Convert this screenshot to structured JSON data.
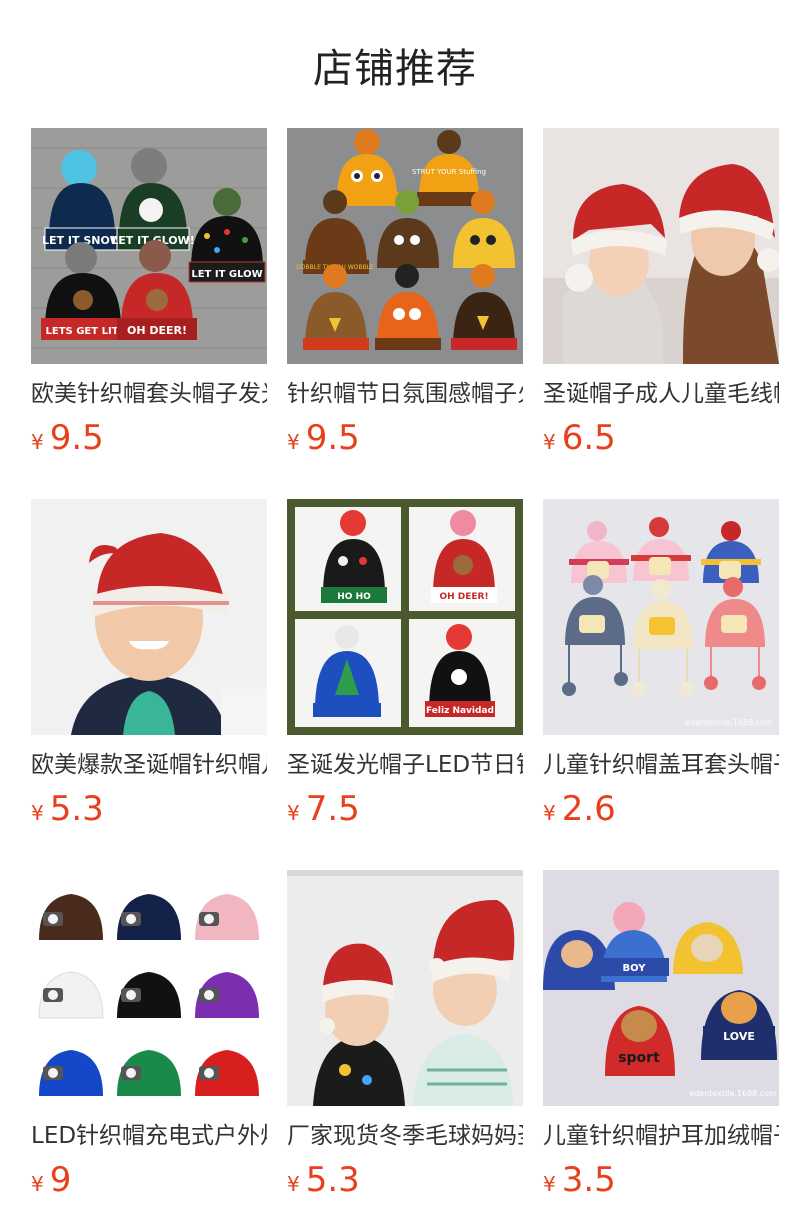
{
  "section": {
    "title": "店铺推荐"
  },
  "products": [
    {
      "name": "欧美针织帽套头帽子发光帽",
      "currency": "¥",
      "price": "9.5",
      "image": "led-christmas-beanies",
      "image_text": [
        "LET IT SNOW",
        "LET IT GLOW!",
        "LET IT GLOW",
        "LETS GET LIT",
        "OH DEER!"
      ]
    },
    {
      "name": "针织帽节日氛围感帽子火鸡帽",
      "currency": "¥",
      "price": "9.5",
      "image": "turkey-beanies",
      "image_text": [
        "STRUT YOUR Stuffing",
        "GOBBLE TIL YOU WOBBLE"
      ]
    },
    {
      "name": "圣诞帽子成人儿童毛线帽",
      "currency": "¥",
      "price": "6.5",
      "image": "santa-hats-mother-child",
      "image_text": []
    },
    {
      "name": "欧美爆款圣诞帽针织帽儿童",
      "currency": "¥",
      "price": "5.3",
      "image": "child-red-knit-hat",
      "image_text": []
    },
    {
      "name": "圣诞发光帽子LED节日针织帽",
      "currency": "¥",
      "price": "7.5",
      "image": "led-christmas-beanies-grid",
      "image_text": [
        "HO HO",
        "OH DEER!",
        "Feliz Navidad"
      ]
    },
    {
      "name": "儿童针织帽盖耳套头帽子",
      "currency": "¥",
      "price": "2.6",
      "image": "kids-earflap-hats",
      "image_text": [
        "edentextile.1688.com"
      ]
    },
    {
      "name": "LED针织帽充电式户外灯帽",
      "currency": "¥",
      "price": "9",
      "image": "led-headlamp-beanies",
      "image_text": []
    },
    {
      "name": "厂家现货冬季毛球妈妈圣诞帽",
      "currency": "¥",
      "price": "5.3",
      "image": "kids-santa-hats",
      "image_text": []
    },
    {
      "name": "儿童针织帽护耳加绒帽子",
      "currency": "¥",
      "price": "3.5",
      "image": "kids-animal-knit-hats",
      "image_text": [
        "BOY",
        "sport",
        "LOVE",
        "edentextile.1688.com"
      ]
    }
  ],
  "colors": {
    "price": "#e8401c",
    "title": "#222222",
    "name": "#333333"
  }
}
